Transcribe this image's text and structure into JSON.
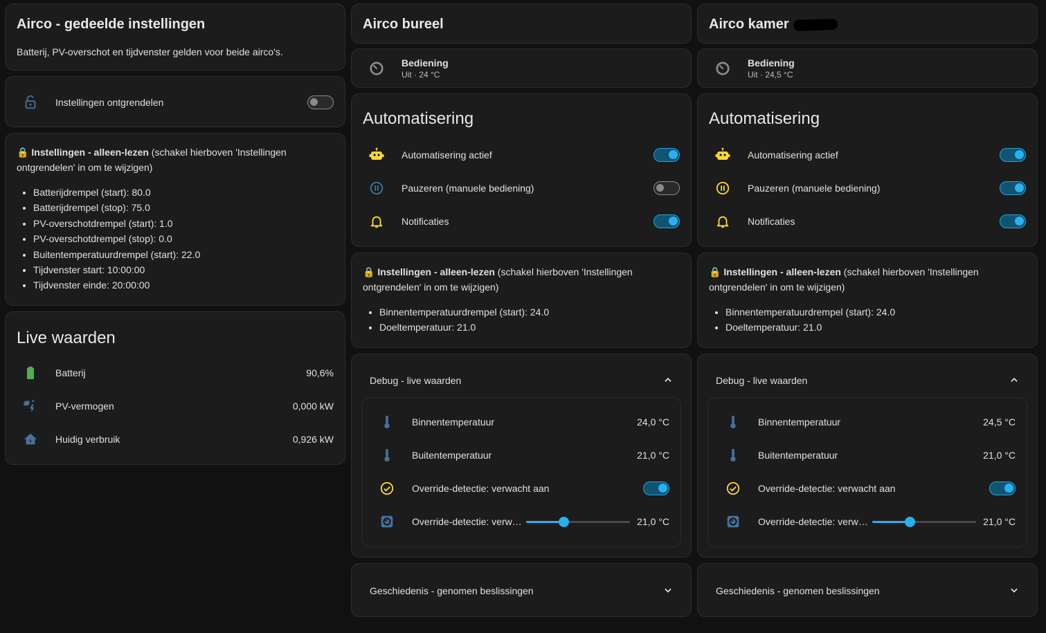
{
  "colors": {
    "accent": "#2ab0ef",
    "amber": "#fdd835",
    "battery": "#4caf50",
    "blue_icon": "#44739e",
    "card_bg": "#1c1c1c",
    "page_bg": "#111111"
  },
  "shared": {
    "title": "Airco - gedeelde instellingen",
    "subtitle": "Batterij, PV-overschot en tijdvenster gelden voor beide airco's.",
    "unlock_label": "Instellingen ontgrendelen",
    "readonly_bold": "🔒 Instellingen - alleen-lezen",
    "readonly_rest": " (schakel hierboven 'Instellingen ontgrendelen' in om te wijzigen)",
    "settings": [
      "Batterijdrempel (start): 80.0",
      "Batterijdrempel (stop): 75.0",
      "PV-overschotdrempel (start): 1.0",
      "PV-overschotdrempel (stop): 0.0",
      "Buitentemperatuurdrempel (start): 22.0",
      "Tijdvenster start: 10:00:00",
      "Tijdvenster einde: 20:00:00"
    ],
    "live_title": "Live waarden",
    "live": [
      {
        "label": "Batterij",
        "value": "90,6%",
        "icon": "battery-icon"
      },
      {
        "label": "PV-vermogen",
        "value": "0,000 kW",
        "icon": "solar-power-icon"
      },
      {
        "label": "Huidig verbruik",
        "value": "0,926 kW",
        "icon": "home-lightning-icon"
      }
    ]
  },
  "units": [
    {
      "title": "Airco bureel",
      "control_label": "Bediening",
      "control_state": "Uit · 24 °C",
      "auto_title": "Automatisering",
      "toggles": [
        {
          "label": "Automatisering actief",
          "on": true
        },
        {
          "label": "Pauzeren (manuele bediening)",
          "on": false
        },
        {
          "label": "Notificaties",
          "on": true
        }
      ],
      "readonly_bold": "🔒 Instellingen - alleen-lezen",
      "readonly_rest": " (schakel hierboven 'Instellingen ontgrendelen' in om te wijzigen)",
      "settings": [
        "Binnentemperatuurdrempel (start): 24.0",
        "Doeltemperatuur: 21.0"
      ],
      "debug_title": "Debug - live waarden",
      "debug": [
        {
          "label": "Binnentemperatuur",
          "value": "24,0 °C"
        },
        {
          "label": "Buitentemperatuur",
          "value": "21,0 °C"
        },
        {
          "label": "Override-detectie: verwacht aan",
          "on": true
        },
        {
          "label": "Override-detectie: verw…",
          "value": "21,0 °C",
          "slider_fraction": 0.36
        }
      ],
      "history_title": "Geschiedenis - genomen beslissingen"
    },
    {
      "title": "Airco kamer",
      "control_label": "Bediening",
      "control_state": "Uit · 24,5 °C",
      "auto_title": "Automatisering",
      "toggles": [
        {
          "label": "Automatisering actief",
          "on": true
        },
        {
          "label": "Pauzeren (manuele bediening)",
          "on": true
        },
        {
          "label": "Notificaties",
          "on": true
        }
      ],
      "readonly_bold": "🔒 Instellingen - alleen-lezen",
      "readonly_rest": " (schakel hierboven 'Instellingen ontgrendelen' in om te wijzigen)",
      "settings": [
        "Binnentemperatuurdrempel (start): 24.0",
        "Doeltemperatuur: 21.0"
      ],
      "debug_title": "Debug - live waarden",
      "debug": [
        {
          "label": "Binnentemperatuur",
          "value": "24,5 °C"
        },
        {
          "label": "Buitentemperatuur",
          "value": "21,0 °C"
        },
        {
          "label": "Override-detectie: verwacht aan",
          "on": true
        },
        {
          "label": "Override-detectie: verw…",
          "value": "21,0 °C",
          "slider_fraction": 0.36
        }
      ],
      "history_title": "Geschiedenis - genomen beslissingen"
    }
  ]
}
